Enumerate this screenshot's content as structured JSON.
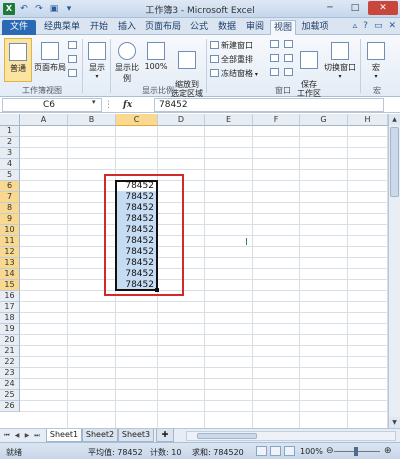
{
  "window": {
    "title": "工作簿3 - Microsoft Excel",
    "quick_access": [
      "save-icon",
      "undo-icon",
      "redo-icon"
    ],
    "min": "─",
    "max": "□",
    "close": "✕"
  },
  "tabs": [
    "文件",
    "经典菜单",
    "开始",
    "插入",
    "页面布局",
    "公式",
    "数据",
    "审阅",
    "视图",
    "加载项"
  ],
  "active_tab": "视图",
  "ribbon": {
    "normal": "普通",
    "page_layout": "页面布局",
    "show": "显示",
    "zoom": "显示比例",
    "zoom100": "100%",
    "zoom_selection": "缩放到\n选定区域",
    "new_window": "新建窗口",
    "arrange_all": "全部重排",
    "freeze_panes": "冻结窗格",
    "save_workspace": "保存\n工作区",
    "switch_window": "切换窗口",
    "macro": "宏",
    "group_workbook_views": "工作簿视图",
    "group_zoom": "显示比例",
    "group_window": "窗口",
    "group_macro": "宏"
  },
  "formula_bar": {
    "name_box": "C6",
    "fx": "fx",
    "value": "78452"
  },
  "columns": [
    "A",
    "B",
    "C",
    "D",
    "E",
    "F",
    "G",
    "H"
  ],
  "rows": [
    "1",
    "2",
    "3",
    "4",
    "5",
    "6",
    "7",
    "8",
    "9",
    "10",
    "11",
    "12",
    "13",
    "14",
    "15",
    "16",
    "17",
    "18",
    "19",
    "20",
    "21",
    "22",
    "23",
    "24",
    "25",
    "26"
  ],
  "cells": {
    "C6": "78452",
    "C7": "78452",
    "C8": "78452",
    "C9": "78452",
    "C10": "78452",
    "C11": "78452",
    "C12": "78452",
    "C13": "78452",
    "C14": "78452",
    "C15": "78452"
  },
  "sheets": [
    "Sheet1",
    "Sheet2",
    "Sheet3"
  ],
  "active_sheet": "Sheet1",
  "status": {
    "ready": "就绪",
    "average": "平均值: 78452",
    "count": "计数: 10",
    "sum": "求和: 784520",
    "zoom": "100%"
  }
}
